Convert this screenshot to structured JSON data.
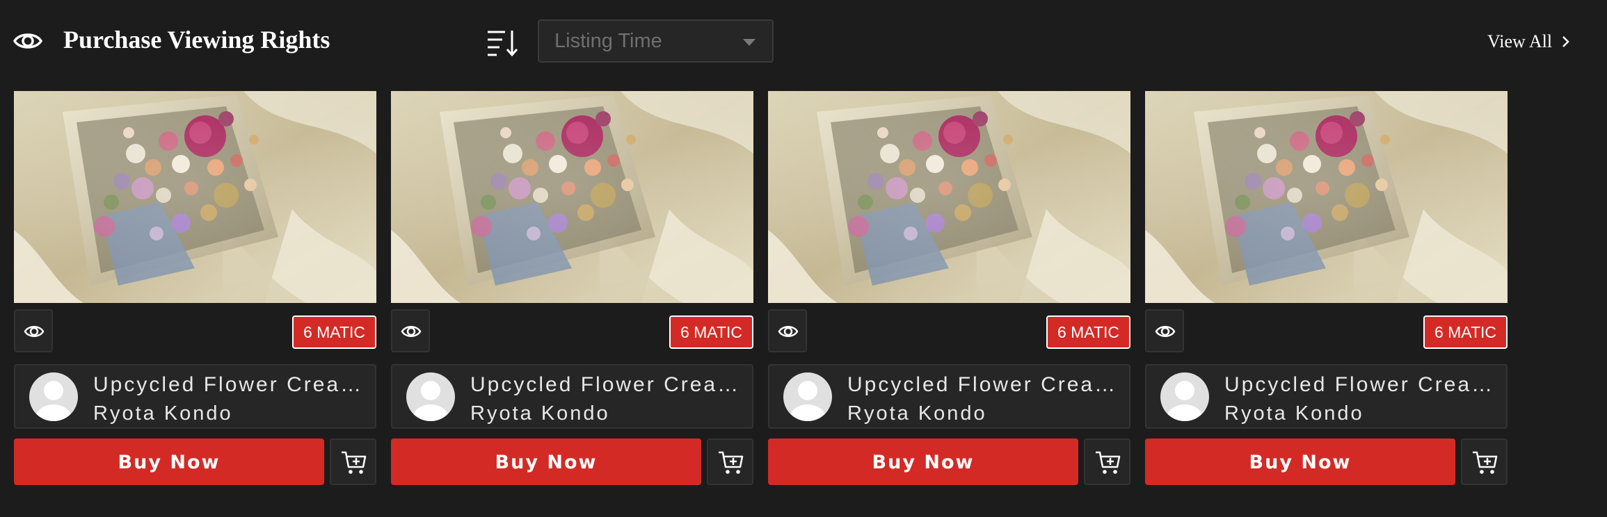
{
  "header": {
    "title": "Purchase Viewing Rights",
    "sort_select_value": "Listing Time",
    "view_all_label": "View All"
  },
  "icons": {
    "title": "eye-icon",
    "sort": "sort-descending-icon",
    "dropdown": "caret-down-icon",
    "view_all": "chevron-right-icon",
    "card_view": "eye-icon",
    "avatar": "user-avatar-placeholder",
    "cart": "add-to-cart-icon"
  },
  "colors": {
    "background": "#1c1c1c",
    "panel": "#262626",
    "accent_red": "#d42a26",
    "text": "#ffffff",
    "muted_text": "#6f6f6f"
  },
  "cards": [
    {
      "price": "6 MATIC",
      "title": "Upcycled Flower Creation",
      "creator": "Ryota Kondo",
      "buy_label": "Buy Now"
    },
    {
      "price": "6 MATIC",
      "title": "Upcycled Flower Creation",
      "creator": "Ryota Kondo",
      "buy_label": "Buy Now"
    },
    {
      "price": "6 MATIC",
      "title": "Upcycled Flower Creation",
      "creator": "Ryota Kondo",
      "buy_label": "Buy Now"
    },
    {
      "price": "6 MATIC",
      "title": "Upcycled Flower Creation",
      "creator": "Ryota Kondo",
      "buy_label": "Buy Now"
    }
  ]
}
